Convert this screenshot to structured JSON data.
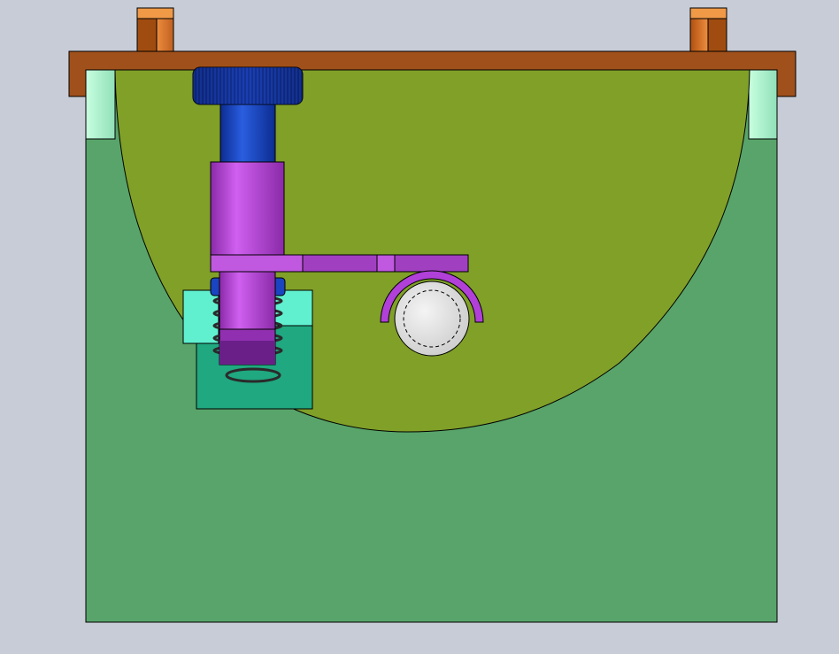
{
  "scene": {
    "background": "#c8ccd6",
    "parts": [
      {
        "name": "top-plate",
        "color": "#a0501a"
      },
      {
        "name": "locating-pin",
        "color": "#e8812c"
      },
      {
        "name": "base-body",
        "color": "#58a46a"
      },
      {
        "name": "corner-block",
        "color": "#a8f0c8"
      },
      {
        "name": "workpiece-disc",
        "color": "#80a028"
      },
      {
        "name": "knurled-knob",
        "color": "#1030a0"
      },
      {
        "name": "plunger-shaft",
        "color": "#1848c8"
      },
      {
        "name": "plunger-housing",
        "color": "#b848d8"
      },
      {
        "name": "clamp-arm",
        "color": "#a040c0"
      },
      {
        "name": "support-bracket",
        "color": "#20a880"
      },
      {
        "name": "compression-spring",
        "color": "#404040"
      },
      {
        "name": "round-boss",
        "color": "#e4e4e4"
      }
    ]
  }
}
